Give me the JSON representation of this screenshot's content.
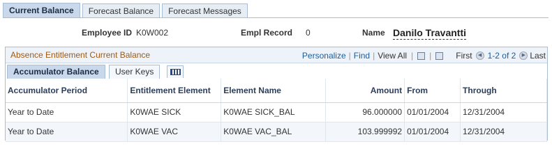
{
  "page_tabs": [
    {
      "label": "Current Balance",
      "active": true
    },
    {
      "label": "Forecast Balance",
      "active": false
    },
    {
      "label": "Forecast Messages",
      "active": false
    }
  ],
  "header": {
    "employee_id_label": "Employee ID",
    "employee_id_value": "K0W002",
    "empl_record_label": "Empl Record",
    "empl_record_value": "0",
    "name_label": "Name",
    "name_value": "Danilo Travantti"
  },
  "grid": {
    "title": "Absence Entitlement Current Balance",
    "nav": {
      "personalize": "Personalize",
      "find": "Find",
      "view_all": "View All",
      "first": "First",
      "range": "1-2 of 2",
      "last": "Last"
    },
    "tabs": [
      {
        "label": "Accumulator Balance",
        "active": true
      },
      {
        "label": "User Keys",
        "active": false
      }
    ],
    "show_all_columns_icon": "show-all-columns-icon",
    "columns": [
      "Accumulator Period",
      "Entitlement Element",
      "Element Name",
      "Amount",
      "From",
      "Through"
    ],
    "rows": [
      [
        "Year to Date",
        "K0WAE SICK",
        "K0WAE SICK_BAL",
        "96.000000",
        "01/01/2004",
        "12/31/2004"
      ],
      [
        "Year to Date",
        "K0WAE VAC",
        "K0WAE VAC_BAL",
        "103.999992",
        "01/01/2004",
        "12/31/2004"
      ]
    ]
  },
  "colors": {
    "grid_title": "#a05a14",
    "link": "#1e5c99",
    "border": "#a9bed4"
  }
}
